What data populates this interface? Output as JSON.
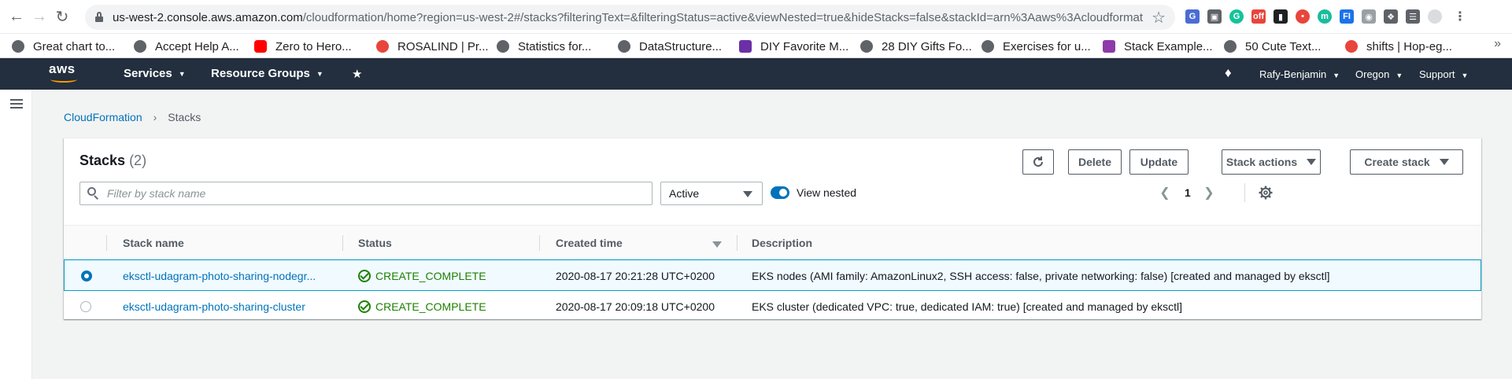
{
  "browser": {
    "url_host": "us-west-2.console.aws.amazon.com",
    "url_path": "/cloudformation/home?region=us-west-2#/stacks?filteringText=&filteringStatus=active&viewNested=true&hideStacks=false&stackId=arn%3Aaws%3Acloudformation%3...",
    "bookmarks": [
      {
        "label": "Great chart to...",
        "color": "#5f6368"
      },
      {
        "label": "Accept Help A...",
        "color": "#5f6368"
      },
      {
        "label": "Zero to Hero...",
        "color": "#ff0000"
      },
      {
        "label": "ROSALIND | Pr...",
        "color": "#e8453c"
      },
      {
        "label": "Statistics for...",
        "color": "#5f6368"
      },
      {
        "label": "DataStructure...",
        "color": "#5f6368"
      },
      {
        "label": "DIY Favorite M...",
        "color": "#6b2fa8"
      },
      {
        "label": "28 DIY Gifts Fo...",
        "color": "#5f6368"
      },
      {
        "label": "Exercises for u...",
        "color": "#5f6368"
      },
      {
        "label": "Stack Example...",
        "color": "#8e3aa8"
      },
      {
        "label": "50 Cute Text...",
        "color": "#5f6368"
      },
      {
        "label": "shifts | Hop-eg...",
        "color": "#e8453c"
      }
    ]
  },
  "aws": {
    "logo": "aws",
    "services_label": "Services",
    "resource_groups_label": "Resource Groups",
    "user_label": "Rafy-Benjamin",
    "region_label": "Oregon",
    "support_label": "Support"
  },
  "breadcrumb": {
    "root": "CloudFormation",
    "current": "Stacks"
  },
  "stacks": {
    "title": "Stacks",
    "count": "(2)",
    "buttons": {
      "delete": "Delete",
      "update": "Update",
      "stack_actions": "Stack actions",
      "create_stack": "Create stack"
    },
    "filter_placeholder": "Filter by stack name",
    "status_filter": "Active",
    "view_nested_label": "View nested",
    "view_nested_on": true,
    "page": "1",
    "columns": {
      "name": "Stack name",
      "status": "Status",
      "created": "Created time",
      "description": "Description"
    },
    "rows": [
      {
        "name": "eksctl-udagram-photo-sharing-nodegr...",
        "status": "CREATE_COMPLETE",
        "created": "2020-08-17 20:21:28 UTC+0200",
        "description": "EKS nodes (AMI family: AmazonLinux2, SSH access: false, private networking: false) [created and managed by eksctl]",
        "selected": true
      },
      {
        "name": "eksctl-udagram-photo-sharing-cluster",
        "status": "CREATE_COMPLETE",
        "created": "2020-08-17 20:09:18 UTC+0200",
        "description": "EKS cluster (dedicated VPC: true, dedicated IAM: true) [created and managed by eksctl]",
        "selected": false
      }
    ]
  },
  "colors": {
    "aws_header": "#232f3e",
    "link": "#0073bb",
    "success": "#1d8102",
    "selected_row_border": "#00a1c9"
  }
}
